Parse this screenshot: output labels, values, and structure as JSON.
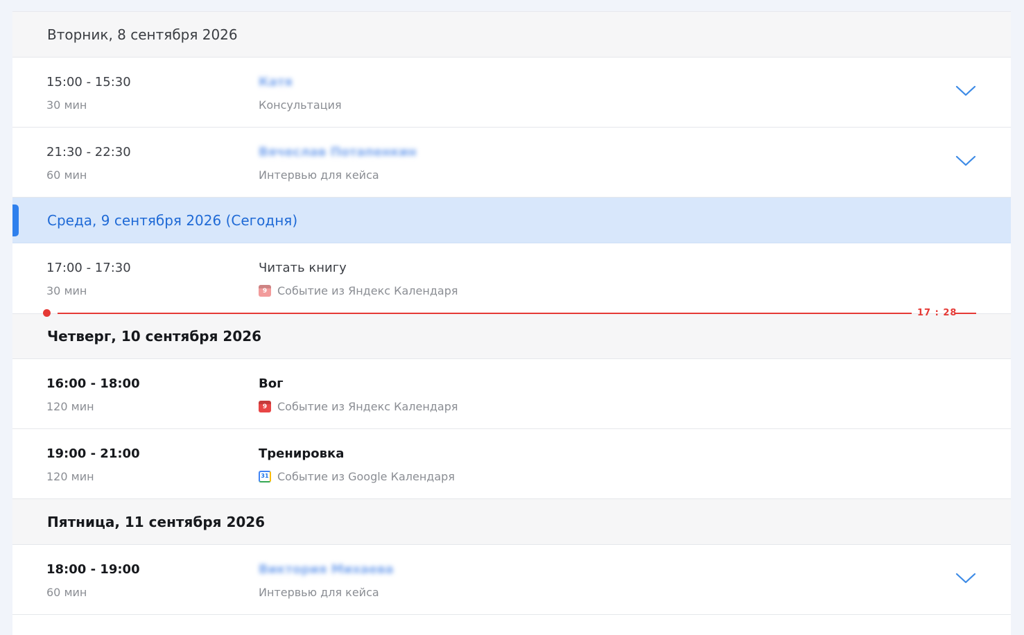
{
  "days": [
    {
      "header": "Вторник, 8 сентября 2026",
      "events": [
        {
          "time": "15:00 - 15:30",
          "duration": "30 мин",
          "title": "Катя",
          "subtitle": "Консультация",
          "expand_icon": "chevron-down-icon"
        },
        {
          "time": "21:30 - 22:30",
          "duration": "60 мин",
          "title": "Вячеслав Потапенкин",
          "subtitle": "Интервью для кейса",
          "expand_icon": "chevron-down-icon"
        }
      ]
    },
    {
      "header": "Среда, 9 сентября 2026 (Сегодня)",
      "events": [
        {
          "time": "17:00 - 17:30",
          "duration": "30 мин",
          "title": "Читать книгу",
          "subtitle": "Событие из Яндекс Календаря",
          "icon": "yandex-calendar-icon"
        }
      ]
    },
    {
      "header": "Четверг, 10 сентября 2026",
      "events": [
        {
          "time": "16:00 - 18:00",
          "duration": "120 мин",
          "title": "Вог",
          "subtitle": "Событие из Яндекс Календаря",
          "icon": "yandex-calendar-icon"
        },
        {
          "time": "19:00 - 21:00",
          "duration": "120 мин",
          "title": "Тренировка",
          "subtitle": "Событие из Google Календаря",
          "icon": "google-calendar-icon"
        }
      ]
    },
    {
      "header": "Пятница, 11 сентября 2026",
      "events": [
        {
          "time": "18:00 - 19:00",
          "duration": "60 мин",
          "title": "Виктория Михаева",
          "subtitle": "Интервью для кейса",
          "expand_icon": "chevron-down-icon"
        }
      ]
    }
  ],
  "now_indicator": {
    "label": "17 : 28"
  },
  "colors": {
    "accent": "#2f80ed",
    "today_bg": "#d8e7fb",
    "now_line": "#e53935",
    "yandex": "#e84545"
  }
}
